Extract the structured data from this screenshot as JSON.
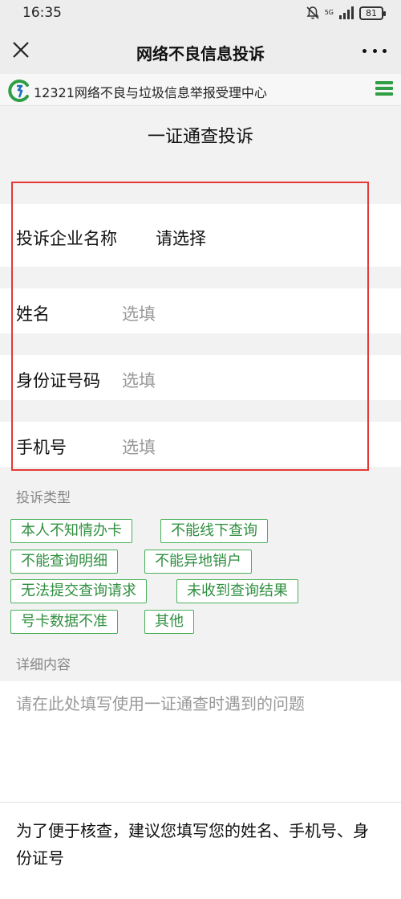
{
  "status_bar": {
    "time": "16:35",
    "network": "5G",
    "battery": "81",
    "icons": [
      "mute-icon",
      "signal-icon",
      "battery-icon"
    ]
  },
  "title_bar": {
    "title": "网络不良信息投诉",
    "close_icon": "close-icon",
    "more_icon": "more-icon"
  },
  "site_header": {
    "name": "12321网络不良与垃圾信息举报受理中心",
    "logo_icon": "site-logo-icon",
    "menu_icon": "menu-icon",
    "accent_color": "#2f9e44"
  },
  "page": {
    "title": "一证通查投诉"
  },
  "form": {
    "company": {
      "label": "投诉企业名称",
      "value": "请选择"
    },
    "name": {
      "label": "姓名",
      "placeholder": "选填"
    },
    "id_number": {
      "label": "身份证号码",
      "placeholder": "选填"
    },
    "phone": {
      "label": "手机号",
      "placeholder": "选填"
    }
  },
  "complaint_type": {
    "label": "投诉类型",
    "options": [
      "本人不知情办卡",
      "不能线下查询",
      "不能查询明细",
      "不能异地销户",
      "无法提交查询请求",
      "未收到查询结果",
      "号卡数据不准",
      "其他"
    ],
    "tag_color": "#48b15a"
  },
  "detail": {
    "label": "详细内容",
    "placeholder": "请在此处填写使用一证通查时遇到的问题"
  },
  "note": {
    "text": "为了便于核查，建议您填写您的姓名、手机号、身份证号"
  },
  "highlight_color": "#e53935"
}
